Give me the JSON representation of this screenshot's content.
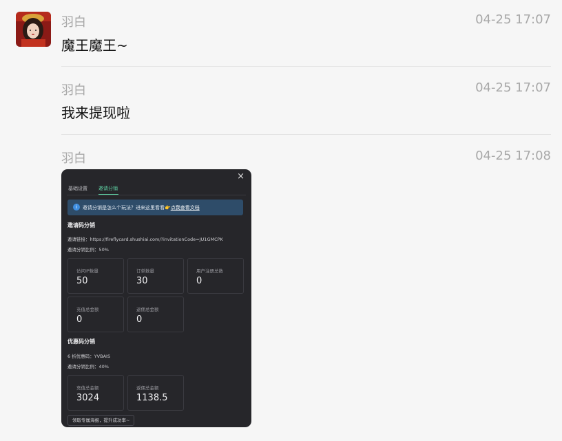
{
  "messages": [
    {
      "sender": "羽白",
      "time": "04-25 17:07",
      "text": "魔王魔王~"
    },
    {
      "sender": "羽白",
      "time": "04-25 17:07",
      "text": "我来提现啦"
    },
    {
      "sender": "羽白",
      "time": "04-25 17:08"
    }
  ],
  "screenshot": {
    "close": "×",
    "tabs": [
      "基础设置",
      "邀请分销"
    ],
    "info": {
      "text": "邀请分销是怎么个玩法？进来这里看看👉",
      "link": "点我查看文档"
    },
    "invite_section": {
      "title": "邀请码分销",
      "link_label": "邀请链接：",
      "link_value": "https://fireflycard.shushiai.com/?invitationCode=JU1GMCPK",
      "ratio_label": "邀请分销比例：",
      "ratio_value": "50%",
      "stats": [
        {
          "label": "访问IP数量",
          "value": "50"
        },
        {
          "label": "订单数量",
          "value": "30"
        },
        {
          "label": "用户注册总数",
          "value": "0"
        },
        {
          "label": "充值总金额",
          "value": "0"
        },
        {
          "label": "返佣总金额",
          "value": "0"
        }
      ]
    },
    "coupon_section": {
      "title": "优惠码分销",
      "code_label": "6 折优惠码：",
      "code_value": "YVBAIS",
      "ratio_label": "邀请分销比例：",
      "ratio_value": "40%",
      "stats": [
        {
          "label": "充值总金额",
          "value": "3024"
        },
        {
          "label": "返佣总金额",
          "value": "1138.5"
        }
      ]
    },
    "cta": "领取专属海报，提升成功率~"
  }
}
